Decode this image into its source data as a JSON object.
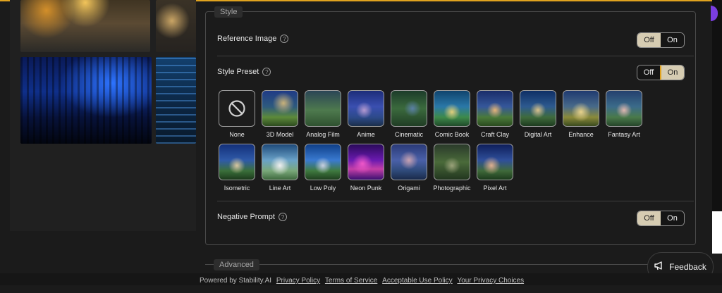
{
  "style_panel": {
    "legend": "Style",
    "reference_image": {
      "label": "Reference Image",
      "help": "?",
      "off": "Off",
      "on": "On",
      "value": "Off"
    },
    "style_preset": {
      "label": "Style Preset",
      "help": "?",
      "off": "Off",
      "on": "On",
      "value": "On"
    },
    "presets": [
      {
        "label": "None",
        "icon": "ban-icon"
      },
      {
        "label": "3D Model"
      },
      {
        "label": "Analog Film"
      },
      {
        "label": "Anime"
      },
      {
        "label": "Cinematic"
      },
      {
        "label": "Comic Book"
      },
      {
        "label": "Craft Clay"
      },
      {
        "label": "Digital Art"
      },
      {
        "label": "Enhance"
      },
      {
        "label": "Fantasy Art"
      },
      {
        "label": "Isometric"
      },
      {
        "label": "Line Art"
      },
      {
        "label": "Low Poly"
      },
      {
        "label": "Neon Punk"
      },
      {
        "label": "Origami"
      },
      {
        "label": "Photographic"
      },
      {
        "label": "Pixel Art"
      }
    ],
    "negative_prompt": {
      "label": "Negative Prompt",
      "help": "?",
      "off": "Off",
      "on": "On",
      "value": "Off"
    }
  },
  "advanced_panel": {
    "legend": "Advanced"
  },
  "feedback": {
    "label": "Feedback",
    "icon": "megaphone-icon"
  },
  "footer": {
    "powered": "Powered by Stability.AI",
    "links": [
      "Privacy Policy",
      "Terms of Service",
      "Acceptable Use Policy",
      "Your Privacy Choices"
    ]
  },
  "colors": {
    "accent": "#e0a31f",
    "toggle_on": "#d6ccb2"
  }
}
